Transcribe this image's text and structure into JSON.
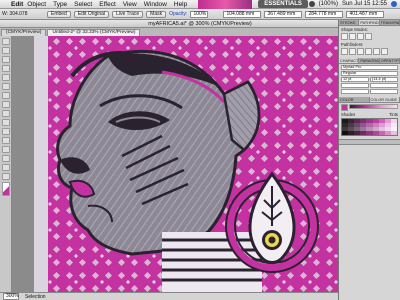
{
  "menubar": {
    "app": "Edit",
    "items": [
      "Object",
      "Type",
      "Select",
      "Effect",
      "View",
      "Window",
      "Help"
    ],
    "workspace": "ESSENTIALS",
    "clock": "Sun Jul 15  12:55",
    "battery": "(100%)"
  },
  "controlbar": {
    "field1": "W: 304.078",
    "label_opacity": "Opacity:",
    "opacity_value": "100%",
    "btn_embed": "Embed",
    "btn_edit": "Edit Original",
    "btn_trace": "Live Trace",
    "btn_mask": "Mask",
    "x_value": "104.088 mm",
    "y_value": "367.489 mm",
    "w_value": "284.778 mm",
    "h_value": "401.487 mm"
  },
  "document": {
    "title": "myAFRICA5.ai* @ 300% (CMYK/Preview)",
    "tabs": [
      "(CMYK/Preview)",
      "Untitled-2* @ 33.33% (CMYK/Preview)"
    ]
  },
  "statusbar": {
    "zoom": "300%",
    "selection_label": "Selection"
  },
  "panels": {
    "top_tabs": [
      "STROKE",
      "PATHFINDER",
      "TRANSPARENCY"
    ],
    "shape_modes": "Shape Modes:",
    "pathfinders": "Pathfinders:",
    "char_tabs": [
      "CHARACTER",
      "PARAGRAPH",
      "OPENTYPE"
    ],
    "font": "Myriad Pro",
    "style": "Regular",
    "size": "12 pt",
    "leading": "(14.4 pt)",
    "color_tabs": [
      "COLOR",
      "COLOR GUIDE"
    ],
    "shades": "Shades",
    "tints": "Tints",
    "swatch_colors": [
      "#1c1c1c",
      "#3a2438",
      "#5a2a56",
      "#7a3074",
      "#9c3690",
      "#bd3ca8",
      "#d85cbd",
      "#e79ad3",
      "#f4d2ec",
      "#2a2a2a",
      "#4a3a48",
      "#6a4a66",
      "#8c5a84",
      "#ad6aa2",
      "#c87fbc",
      "#dca0d0",
      "#ebc4e3",
      "#f7e6f3",
      "#3c3c3c",
      "#5a4e58",
      "#7a6278",
      "#997896",
      "#b890b2",
      "#cfa9cb",
      "#e1c3de",
      "#eedcec",
      "#faf2f8",
      "#101010",
      "#2c1e2a",
      "#48263f",
      "#6a2f5c",
      "#8e3a7a",
      "#b04898",
      "#c966b1",
      "#db90ca",
      "#ecbfe2"
    ]
  },
  "colors": {
    "magenta": "#c431a0",
    "grey": "#8d8896",
    "art_dark": "#2b2230"
  }
}
